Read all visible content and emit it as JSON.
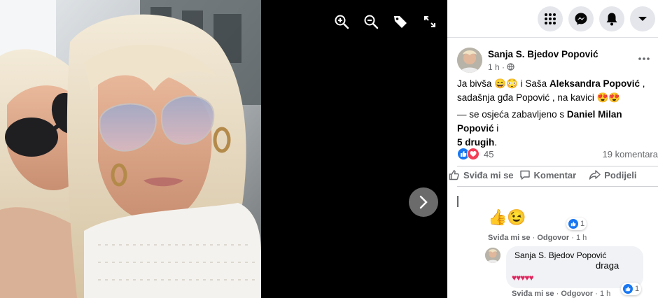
{
  "viewer": {
    "tools": [
      {
        "icon": "zoom-in-icon"
      },
      {
        "icon": "zoom-out-icon"
      },
      {
        "icon": "tag-icon"
      },
      {
        "icon": "fullscreen-icon"
      }
    ],
    "next_icon": "chevron-right-icon"
  },
  "topbar": {
    "buttons": [
      {
        "icon": "menu-grid-icon"
      },
      {
        "icon": "messenger-icon"
      },
      {
        "icon": "notifications-bell-icon"
      },
      {
        "icon": "account-dropdown-icon"
      }
    ]
  },
  "post": {
    "author": "Sanja S. Bjedov Popović",
    "time": "1 h ·",
    "privacy_icon": "globe-icon",
    "text_line1_a": "Ja bivša ",
    "text_line1_emoji": "😄😳",
    "text_line1_b": " i Saša ",
    "text_line1_name": "Aleksandra Popović",
    "text_line1_c": " ,",
    "text_line2_a": "sadašnja gđa Popović , na kavici ",
    "text_line2_emoji": "😍😍",
    "feeling_a": "— se osjeća zabavljeno s ",
    "feeling_name": "Daniel Milan Popović",
    "feeling_b": " i",
    "feeling_more": "5 drugih",
    "feeling_end": ".",
    "reactions_count": "45",
    "comments_count": "19 komentara"
  },
  "actions": {
    "like": "Sviđa mi se",
    "comment": "Komentar",
    "share": "Podijeli"
  },
  "comments": [
    {
      "emojis": "👍😉",
      "like_label": "Sviđa mi se",
      "reply_label": "Odgovor",
      "time": "1 h",
      "reaction_count": "1"
    }
  ],
  "reply": {
    "author": "Sanja S. Bjedov Popović",
    "text": "draga",
    "hearts": "♥♥♥♥♥",
    "like_label": "Sviđa mi se",
    "reply_label": "Odgovor",
    "time": "1 h",
    "reaction_count": "1"
  },
  "colors": {
    "accent": "#1877f2",
    "love": "#f33e58",
    "text_secondary": "#65676b"
  }
}
